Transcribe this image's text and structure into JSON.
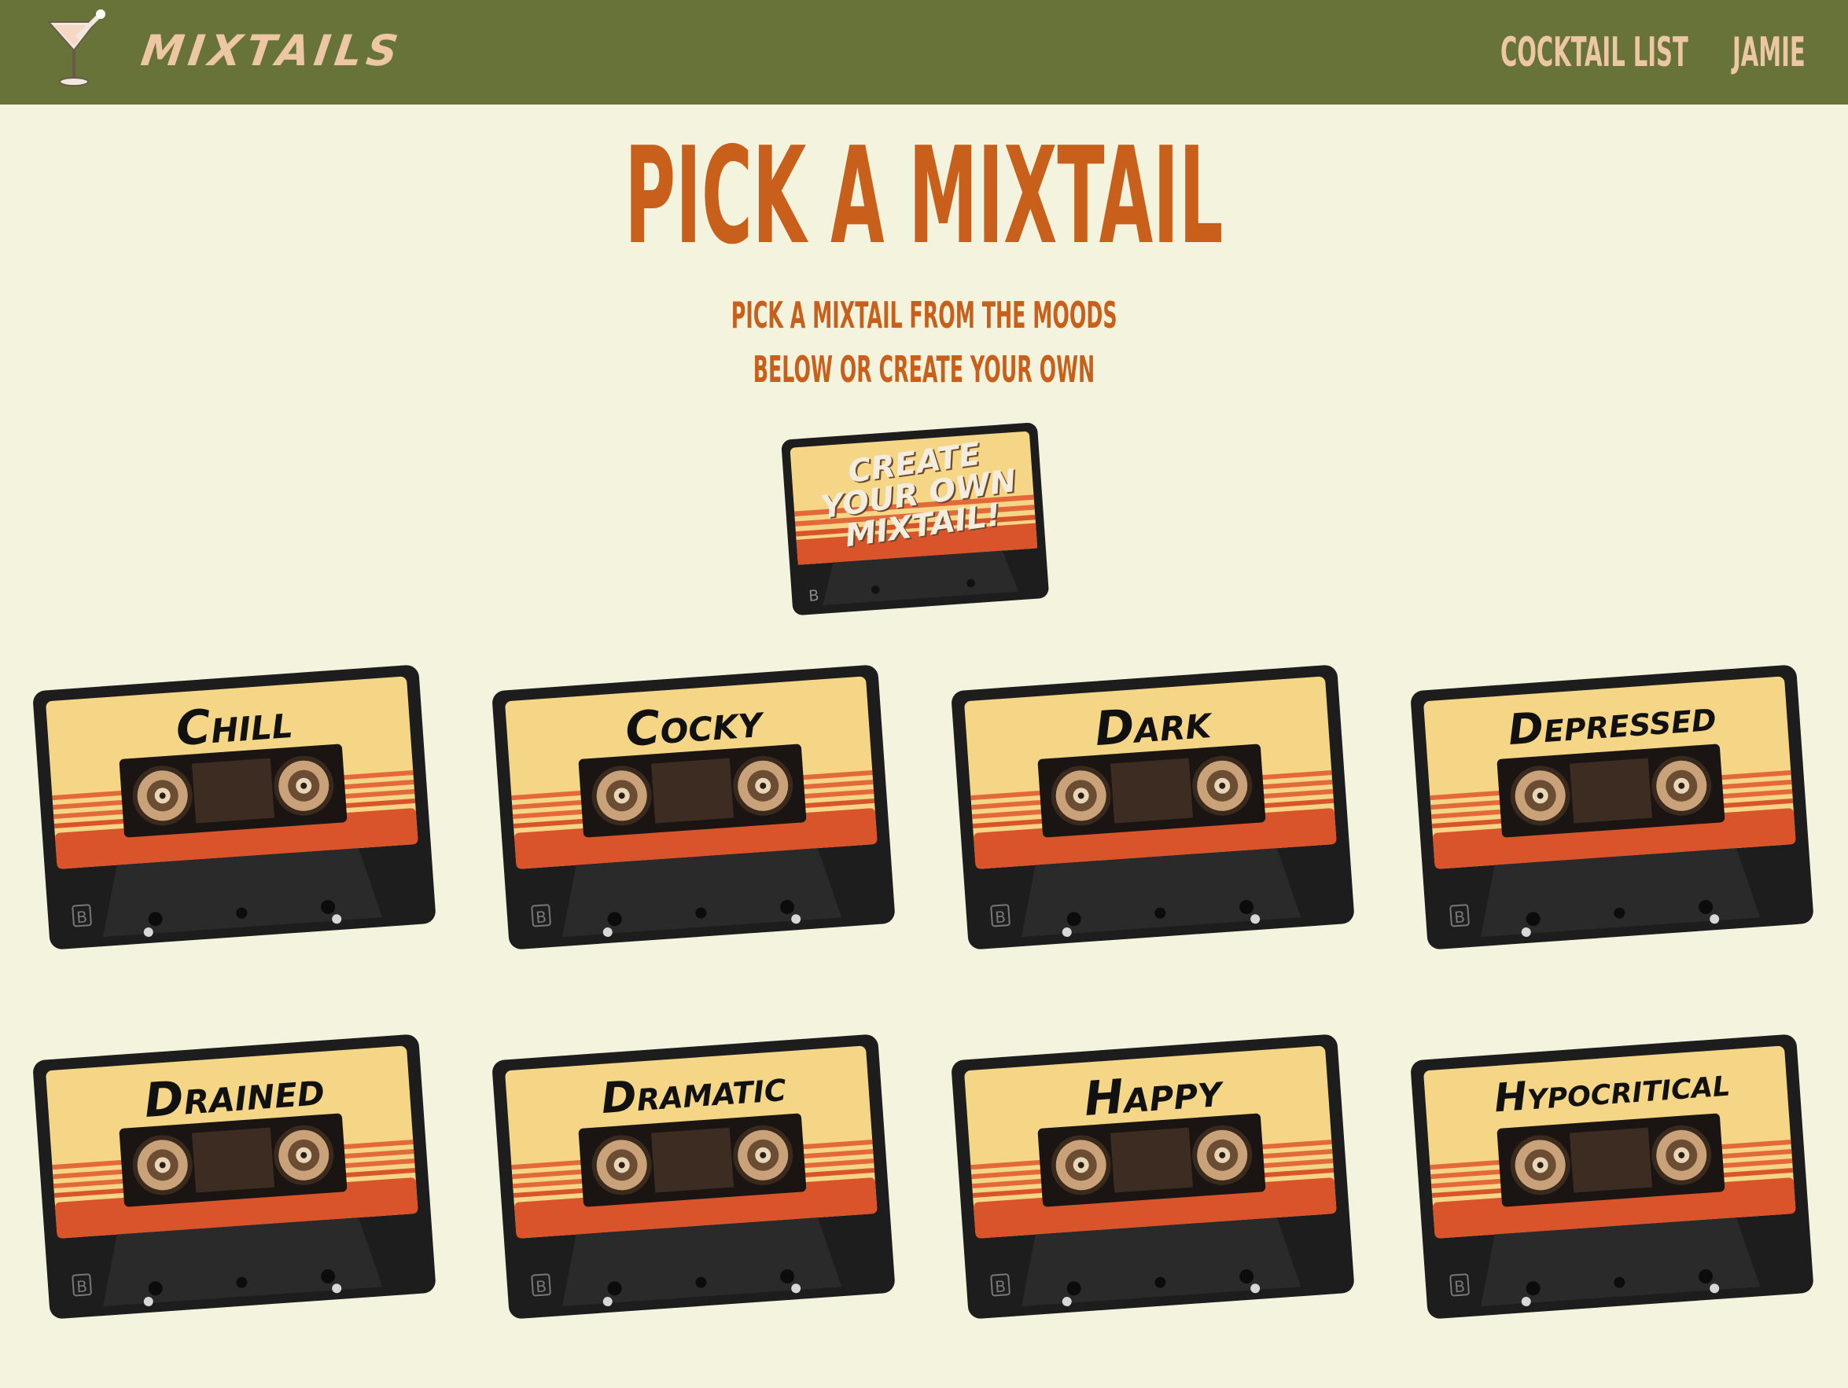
{
  "nav": {
    "brand": "MIXTAILS",
    "logo_icon": "martini-glass-icon",
    "links": [
      "COCKTAIL LIST",
      "JAMIE"
    ]
  },
  "header": {
    "title": "PICK A MIXTAIL",
    "subtitle_line1": "PICK A MIXTAIL FROM THE MOODS",
    "subtitle_line2": "BELOW OR CREATE YOUR OWN"
  },
  "create": {
    "line1": "CREATE",
    "line2": "YOUR OWN",
    "line3": "MIXTAIL!"
  },
  "moods": [
    "Chill",
    "Cocky",
    "Dark",
    "Depressed",
    "Drained",
    "Dramatic",
    "Happy",
    "Hypocritical"
  ],
  "cassette_side": "B",
  "colors": {
    "navbar": "#68733a",
    "nav_text": "#edc7a3",
    "page_bg": "#f4f4de",
    "heading": "#c8601c",
    "cassette_body": "#1d1d1d",
    "label_top": "#f4d686",
    "label_stripe": "#d9542a"
  }
}
